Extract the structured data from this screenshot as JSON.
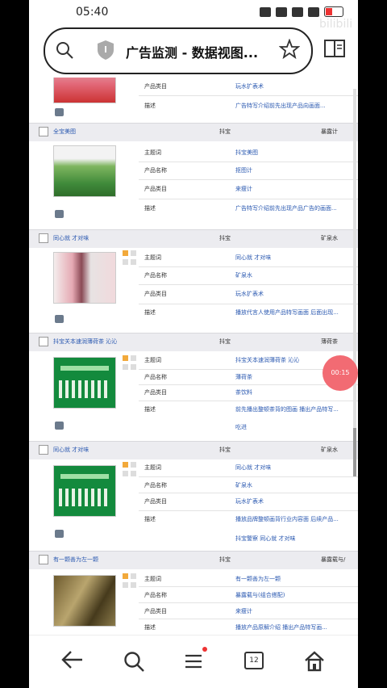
{
  "status": {
    "time": "05:40",
    "watermark": "bilibili"
  },
  "urlbar": {
    "title": "广告监测 - 数据视图..."
  },
  "fab": {
    "label": "00:15"
  },
  "tabs_count": "12",
  "rows": {
    "r0": {
      "product_type": "玩水扩表术",
      "desc": "广告特写介绍前先出现产品向画面..."
    },
    "g1": {
      "title": "全宝美图",
      "mid": "抖宝",
      "right": "暴露计",
      "theme": "抖宝美图",
      "name": "抠图计",
      "type": "来瘦计",
      "desc": "广告特写介绍前先出现产品广告的画面..."
    },
    "g2": {
      "title": "同心就 才对味",
      "mid": "抖宝",
      "right": "矿泉水",
      "theme": "同心就 才对味",
      "name": "矿泉水",
      "type": "玩水扩表术",
      "desc": "播放代言人使用产品特写画面 后面出现..."
    },
    "g3": {
      "title": "抖宝关本速润薄荷茶 沁沁",
      "mid": "抖宝",
      "right": "薄荷茶",
      "theme": "抖宝关本速润薄荷茶 沁沁",
      "name": "薄荷茶",
      "type": "茶饮料",
      "desc": "前先播出整顿茶背的图画 播出产品特写...",
      "extra": "吃进"
    },
    "g4": {
      "title": "同心就 才对味",
      "mid": "抖宝",
      "right": "矿泉水",
      "theme": "同心就 才对味",
      "name": "矿泉水",
      "type": "玩水扩表术",
      "desc": "播放品牌整顿画背行业内容面 后续产品...",
      "extra": "抖宝警察 同心就 才对味"
    },
    "g5": {
      "title": "有一颗善为左一颗",
      "mid": "抖宝",
      "right": "暴露载与/",
      "theme": "有一颗善为左一颗",
      "name": "暴露载与(组合搭配)",
      "type": "来瘦计",
      "desc": "播放产品原解介绍 播出产品特写画..."
    }
  },
  "labels": {
    "theme": "主题词",
    "name": "产品名称",
    "type": "产品类目",
    "desc": "描述"
  },
  "colors": {
    "link": "#2a58b0",
    "fab": "#f26b73",
    "header_bg": "#ececf0"
  }
}
